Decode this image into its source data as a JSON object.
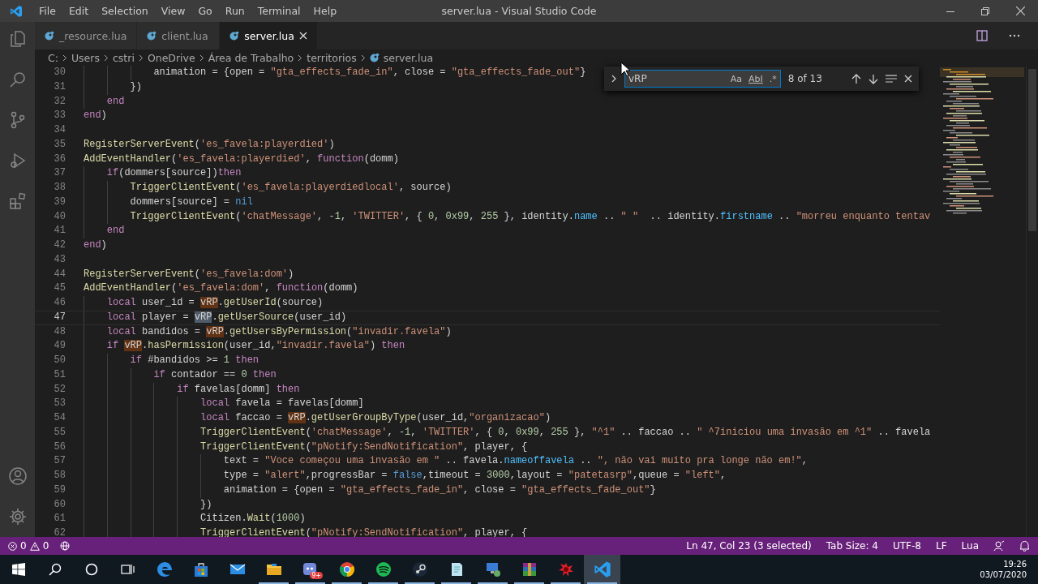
{
  "window": {
    "title": "server.lua - Visual Studio Code"
  },
  "menu": [
    "File",
    "Edit",
    "Selection",
    "View",
    "Go",
    "Run",
    "Terminal",
    "Help"
  ],
  "activity_bar": {
    "top": [
      {
        "kind": "files"
      },
      {
        "kind": "search"
      },
      {
        "kind": "source-control"
      },
      {
        "kind": "run"
      },
      {
        "kind": "extensions"
      }
    ],
    "bottom": [
      {
        "kind": "account"
      },
      {
        "kind": "settings"
      }
    ]
  },
  "tabs": [
    {
      "label": "_resource.lua",
      "selected": false
    },
    {
      "label": "client.lua",
      "selected": false
    },
    {
      "label": "server.lua",
      "selected": true
    }
  ],
  "breadcrumb": [
    {
      "label": "C:",
      "kind": "folder"
    },
    {
      "label": "Users",
      "kind": "folder"
    },
    {
      "label": "cstri",
      "kind": "folder"
    },
    {
      "label": "OneDrive",
      "kind": "folder"
    },
    {
      "label": "Área de Trabalho",
      "kind": "folder"
    },
    {
      "label": "territorios",
      "kind": "folder"
    },
    {
      "label": "server.lua",
      "kind": "file"
    }
  ],
  "find_widget": {
    "value": "vRP",
    "options": [
      "Aa",
      "AbI",
      ".*"
    ],
    "result": "8 of 13"
  },
  "lines": [
    {
      "number": "30",
      "current": false,
      "tokens": [
        {
          "kind": "plain",
          "text": "            animation = {open = "
        },
        {
          "kind": "str",
          "text": "\"gta_effects_fade_in\""
        },
        {
          "kind": "plain",
          "text": ", close = "
        },
        {
          "kind": "str",
          "text": "\"gta_effects_fade_out\""
        },
        {
          "kind": "plain",
          "text": "}"
        }
      ]
    },
    {
      "number": "31",
      "current": false,
      "tokens": [
        {
          "kind": "plain",
          "text": "        })"
        }
      ]
    },
    {
      "number": "32",
      "current": false,
      "tokens": [
        {
          "kind": "kw",
          "text": "    end"
        }
      ]
    },
    {
      "number": "33",
      "current": false,
      "tokens": [
        {
          "kind": "kw",
          "text": "end"
        },
        {
          "kind": "plain",
          "text": ")"
        }
      ]
    },
    {
      "number": "34",
      "current": false
    },
    {
      "number": "35",
      "current": false,
      "tokens": [
        {
          "kind": "fn",
          "text": "RegisterServerEvent"
        },
        {
          "kind": "plain",
          "text": "("
        },
        {
          "kind": "str",
          "text": "'es_favela:playerdied'"
        },
        {
          "kind": "plain",
          "text": ")"
        }
      ]
    },
    {
      "number": "36",
      "current": false,
      "tokens": [
        {
          "kind": "fn",
          "text": "AddEventHandler"
        },
        {
          "kind": "plain",
          "text": "("
        },
        {
          "kind": "str",
          "text": "'es_favela:playerdied'"
        },
        {
          "kind": "plain",
          "text": ", "
        },
        {
          "kind": "kw",
          "text": "function"
        },
        {
          "kind": "plain",
          "text": "(domm)"
        }
      ]
    },
    {
      "number": "37",
      "current": false,
      "tokens": [
        {
          "kind": "kw",
          "text": "    if"
        },
        {
          "kind": "plain",
          "text": "(dommers[source])"
        },
        {
          "kind": "kw",
          "text": "then"
        }
      ]
    },
    {
      "number": "38",
      "current": false,
      "tokens": [
        {
          "kind": "fn",
          "text": "        TriggerClientEvent"
        },
        {
          "kind": "plain",
          "text": "("
        },
        {
          "kind": "str",
          "text": "'es_favela:playerdiedlocal'"
        },
        {
          "kind": "plain",
          "text": ", source)"
        }
      ]
    },
    {
      "number": "39",
      "current": false,
      "tokens": [
        {
          "kind": "plain",
          "text": "        dommers[source] = "
        },
        {
          "kind": "const",
          "text": "nil"
        }
      ]
    },
    {
      "number": "40",
      "current": false,
      "tokens": [
        {
          "kind": "fn",
          "text": "        TriggerClientEvent"
        },
        {
          "kind": "plain",
          "text": "("
        },
        {
          "kind": "str",
          "text": "'chatMessage'"
        },
        {
          "kind": "plain",
          "text": ", "
        },
        {
          "kind": "num",
          "text": "-1"
        },
        {
          "kind": "plain",
          "text": ", "
        },
        {
          "kind": "str",
          "text": "'TWITTER'"
        },
        {
          "kind": "plain",
          "text": ", { "
        },
        {
          "kind": "num",
          "text": "0"
        },
        {
          "kind": "plain",
          "text": ", "
        },
        {
          "kind": "num",
          "text": "0x99"
        },
        {
          "kind": "plain",
          "text": ", "
        },
        {
          "kind": "num",
          "text": "255"
        },
        {
          "kind": "plain",
          "text": " }, identity."
        },
        {
          "kind": "prop",
          "text": "name"
        },
        {
          "kind": "plain",
          "text": " .. "
        },
        {
          "kind": "str",
          "text": "\" \""
        },
        {
          "kind": "plain",
          "text": "  .. identity."
        },
        {
          "kind": "prop",
          "text": "firstname"
        },
        {
          "kind": "plain",
          "text": " .. "
        },
        {
          "kind": "str",
          "text": "\"morreu enquanto tentav"
        }
      ]
    },
    {
      "number": "41",
      "current": false,
      "tokens": [
        {
          "kind": "kw",
          "text": "    end"
        }
      ]
    },
    {
      "number": "42",
      "current": false,
      "tokens": [
        {
          "kind": "kw",
          "text": "end"
        },
        {
          "kind": "plain",
          "text": ")"
        }
      ]
    },
    {
      "number": "43",
      "current": false
    },
    {
      "number": "44",
      "current": false,
      "tokens": [
        {
          "kind": "fn",
          "text": "RegisterServerEvent"
        },
        {
          "kind": "plain",
          "text": "("
        },
        {
          "kind": "str",
          "text": "'es_favela:dom'"
        },
        {
          "kind": "plain",
          "text": ")"
        }
      ]
    },
    {
      "number": "45",
      "current": false,
      "tokens": [
        {
          "kind": "fn",
          "text": "AddEventHandler"
        },
        {
          "kind": "plain",
          "text": "("
        },
        {
          "kind": "str",
          "text": "'es_favela:dom'"
        },
        {
          "kind": "plain",
          "text": ", "
        },
        {
          "kind": "kw",
          "text": "function"
        },
        {
          "kind": "plain",
          "text": "(domm)"
        }
      ]
    },
    {
      "number": "46",
      "current": false,
      "tokens": [
        {
          "kind": "kw",
          "text": "    local"
        },
        {
          "kind": "plain",
          "text": " user_id = "
        },
        {
          "kind": "match",
          "text": "vRP",
          "selected": false
        },
        {
          "kind": "plain",
          "text": "."
        },
        {
          "kind": "fn",
          "text": "getUserId"
        },
        {
          "kind": "plain",
          "text": "(source)"
        }
      ]
    },
    {
      "number": "47",
      "current": true,
      "tokens": [
        {
          "kind": "kw",
          "text": "    local"
        },
        {
          "kind": "plain",
          "text": " player = "
        },
        {
          "kind": "match",
          "text": "vRP",
          "selected": true
        },
        {
          "kind": "plain",
          "text": "."
        },
        {
          "kind": "fn",
          "text": "getUserSource"
        },
        {
          "kind": "plain",
          "text": "(user_id)"
        }
      ]
    },
    {
      "number": "48",
      "current": false,
      "tokens": [
        {
          "kind": "kw",
          "text": "    local"
        },
        {
          "kind": "plain",
          "text": " bandidos = "
        },
        {
          "kind": "match",
          "text": "vRP",
          "selected": false
        },
        {
          "kind": "plain",
          "text": "."
        },
        {
          "kind": "fn",
          "text": "getUsersByPermission"
        },
        {
          "kind": "plain",
          "text": "("
        },
        {
          "kind": "str",
          "text": "\"invadir.favela\""
        },
        {
          "kind": "plain",
          "text": ")"
        }
      ]
    },
    {
      "number": "49",
      "current": false,
      "tokens": [
        {
          "kind": "kw",
          "text": "    if "
        },
        {
          "kind": "match",
          "text": "vRP",
          "selected": false
        },
        {
          "kind": "plain",
          "text": "."
        },
        {
          "kind": "fn",
          "text": "hasPermission"
        },
        {
          "kind": "plain",
          "text": "(user_id,"
        },
        {
          "kind": "str",
          "text": "\"invadir.favela\""
        },
        {
          "kind": "plain",
          "text": ") "
        },
        {
          "kind": "kw",
          "text": "then"
        }
      ]
    },
    {
      "number": "50",
      "current": false,
      "tokens": [
        {
          "kind": "kw",
          "text": "        if"
        },
        {
          "kind": "plain",
          "text": " #bandidos >= "
        },
        {
          "kind": "num",
          "text": "1"
        },
        {
          "kind": "kw",
          "text": " then"
        }
      ]
    },
    {
      "number": "51",
      "current": false,
      "tokens": [
        {
          "kind": "kw",
          "text": "            if"
        },
        {
          "kind": "plain",
          "text": " contador == "
        },
        {
          "kind": "num",
          "text": "0"
        },
        {
          "kind": "kw",
          "text": " then"
        }
      ]
    },
    {
      "number": "52",
      "current": false,
      "tokens": [
        {
          "kind": "kw",
          "text": "                if"
        },
        {
          "kind": "plain",
          "text": " favelas[domm] "
        },
        {
          "kind": "kw",
          "text": "then"
        }
      ]
    },
    {
      "number": "53",
      "current": false,
      "tokens": [
        {
          "kind": "kw",
          "text": "                    local"
        },
        {
          "kind": "plain",
          "text": " favela = favelas[domm]"
        }
      ]
    },
    {
      "number": "54",
      "current": false,
      "tokens": [
        {
          "kind": "kw",
          "text": "                    local"
        },
        {
          "kind": "plain",
          "text": " faccao = "
        },
        {
          "kind": "match",
          "text": "vRP",
          "selected": false
        },
        {
          "kind": "plain",
          "text": "."
        },
        {
          "kind": "fn",
          "text": "getUserGroupByType"
        },
        {
          "kind": "plain",
          "text": "(user_id,"
        },
        {
          "kind": "str",
          "text": "\"organizacao\""
        },
        {
          "kind": "plain",
          "text": ")"
        }
      ]
    },
    {
      "number": "55",
      "current": false,
      "tokens": [
        {
          "kind": "fn",
          "text": "                    TriggerClientEvent"
        },
        {
          "kind": "plain",
          "text": "("
        },
        {
          "kind": "str",
          "text": "'chatMessage'"
        },
        {
          "kind": "plain",
          "text": ", "
        },
        {
          "kind": "num",
          "text": "-1"
        },
        {
          "kind": "plain",
          "text": ", "
        },
        {
          "kind": "str",
          "text": "'TWITTER'"
        },
        {
          "kind": "plain",
          "text": ", { "
        },
        {
          "kind": "num",
          "text": "0"
        },
        {
          "kind": "plain",
          "text": ", "
        },
        {
          "kind": "num",
          "text": "0x99"
        },
        {
          "kind": "plain",
          "text": ", "
        },
        {
          "kind": "num",
          "text": "255"
        },
        {
          "kind": "plain",
          "text": " }, "
        },
        {
          "kind": "str",
          "text": "\"^1\""
        },
        {
          "kind": "plain",
          "text": " .. faccao .. "
        },
        {
          "kind": "str",
          "text": "\" ^7iniciou uma invasão em ^1\""
        },
        {
          "kind": "plain",
          "text": " .. favela"
        }
      ]
    },
    {
      "number": "56",
      "current": false,
      "tokens": [
        {
          "kind": "fn",
          "text": "                    TriggerClientEvent"
        },
        {
          "kind": "plain",
          "text": "("
        },
        {
          "kind": "str",
          "text": "\"pNotify:SendNotification\""
        },
        {
          "kind": "plain",
          "text": ", player, {"
        }
      ]
    },
    {
      "number": "57",
      "current": false,
      "tokens": [
        {
          "kind": "plain",
          "text": "                        text = "
        },
        {
          "kind": "str",
          "text": "\"Voce começou uma invasão em \""
        },
        {
          "kind": "plain",
          "text": " .. favela."
        },
        {
          "kind": "prop",
          "text": "nameoffavela"
        },
        {
          "kind": "plain",
          "text": " .. "
        },
        {
          "kind": "str",
          "text": "\", não vai muito pra longe não em!\""
        },
        {
          "kind": "plain",
          "text": ","
        }
      ]
    },
    {
      "number": "58",
      "current": false,
      "tokens": [
        {
          "kind": "plain",
          "text": "                        type = "
        },
        {
          "kind": "str",
          "text": "\"alert\""
        },
        {
          "kind": "plain",
          "text": ",progressBar = "
        },
        {
          "kind": "const",
          "text": "false"
        },
        {
          "kind": "plain",
          "text": ",timeout = "
        },
        {
          "kind": "num",
          "text": "3000"
        },
        {
          "kind": "plain",
          "text": ",layout = "
        },
        {
          "kind": "str",
          "text": "\"patetasrp\""
        },
        {
          "kind": "plain",
          "text": ",queue = "
        },
        {
          "kind": "str",
          "text": "\"left\""
        },
        {
          "kind": "plain",
          "text": ","
        }
      ]
    },
    {
      "number": "59",
      "current": false,
      "tokens": [
        {
          "kind": "plain",
          "text": "                        animation = {open = "
        },
        {
          "kind": "str",
          "text": "\"gta_effects_fade_in\""
        },
        {
          "kind": "plain",
          "text": ", close = "
        },
        {
          "kind": "str",
          "text": "\"gta_effects_fade_out\""
        },
        {
          "kind": "plain",
          "text": "}"
        }
      ]
    },
    {
      "number": "60",
      "current": false,
      "tokens": [
        {
          "kind": "plain",
          "text": "                    })"
        }
      ]
    },
    {
      "number": "61",
      "current": false,
      "tokens": [
        {
          "kind": "plain",
          "text": "                    Citizen."
        },
        {
          "kind": "fn",
          "text": "Wait"
        },
        {
          "kind": "plain",
          "text": "("
        },
        {
          "kind": "num",
          "text": "1000"
        },
        {
          "kind": "plain",
          "text": ")"
        }
      ]
    },
    {
      "number": "62",
      "current": false,
      "tokens": [
        {
          "kind": "fn",
          "text": "                    TriggerClientEvent"
        },
        {
          "kind": "plain",
          "text": "("
        },
        {
          "kind": "str",
          "text": "\"pNotify:SendNotification\""
        },
        {
          "kind": "plain",
          "text": ", player, {"
        }
      ]
    }
  ],
  "status_bar": {
    "errors": "0",
    "warnings": "0",
    "items": [
      "Ln 47, Col 23 (3 selected)",
      "Tab Size: 4",
      "UTF-8",
      "LF",
      "Lua"
    ]
  },
  "taskbar": {
    "apps": [
      {
        "kind": "edge",
        "running": false
      },
      {
        "kind": "store",
        "running": false
      },
      {
        "kind": "mail",
        "running": false
      },
      {
        "kind": "folder",
        "running": true
      },
      {
        "kind": "chat",
        "running": true,
        "badge": "9+"
      },
      {
        "kind": "chrome",
        "running": true
      },
      {
        "kind": "spotify",
        "running": true
      },
      {
        "kind": "steam",
        "running": true
      },
      {
        "kind": "notepad",
        "running": true
      },
      {
        "kind": "remote",
        "running": true
      },
      {
        "kind": "archive",
        "running": true
      },
      {
        "kind": "red",
        "running": true
      },
      {
        "kind": "vscode",
        "running": true,
        "selected": true
      }
    ],
    "time": "19:26",
    "date": "03/07/2020"
  }
}
